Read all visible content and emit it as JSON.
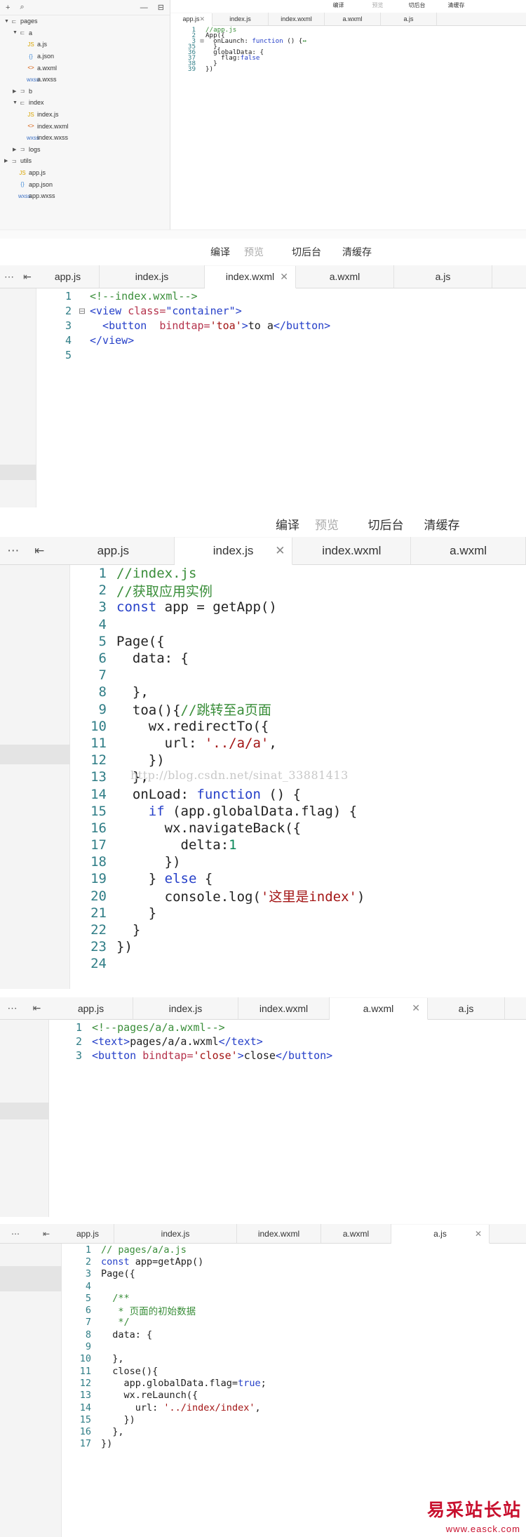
{
  "toolbar": {
    "compile": "编译",
    "preview": "预览",
    "background": "切后台",
    "clear_cache": "清缓存"
  },
  "tree": {
    "items": [
      {
        "label": "pages",
        "kind": "folder",
        "open": true,
        "level": 0
      },
      {
        "label": "a",
        "kind": "folder",
        "open": true,
        "level": 1
      },
      {
        "label": "a.js",
        "kind": "js",
        "level": 2
      },
      {
        "label": "a.json",
        "kind": "json",
        "level": 2
      },
      {
        "label": "a.wxml",
        "kind": "wxml",
        "level": 2
      },
      {
        "label": "a.wxss",
        "kind": "wxss",
        "level": 2
      },
      {
        "label": "b",
        "kind": "folder",
        "open": false,
        "level": 1
      },
      {
        "label": "index",
        "kind": "folder",
        "open": true,
        "level": 1
      },
      {
        "label": "index.js",
        "kind": "js",
        "level": 2
      },
      {
        "label": "index.wxml",
        "kind": "wxml",
        "level": 2
      },
      {
        "label": "index.wxss",
        "kind": "wxss",
        "level": 2
      },
      {
        "label": "logs",
        "kind": "folder",
        "open": false,
        "level": 1
      },
      {
        "label": "utils",
        "kind": "folder",
        "open": false,
        "level": 0
      },
      {
        "label": "app.js",
        "kind": "js",
        "level": 1
      },
      {
        "label": "app.json",
        "kind": "json",
        "level": 1
      },
      {
        "label": "app.wxss",
        "kind": "wxss",
        "level": 1
      }
    ]
  },
  "panels": [
    {
      "tabs": [
        "app.js",
        "index.js",
        "index.wxml",
        "a.wxml",
        "a.js"
      ],
      "active_tab": 0,
      "lines": [
        {
          "n": "1",
          "fold": "",
          "tokens": [
            {
              "t": "//app.js",
              "c": "c-cm"
            }
          ]
        },
        {
          "n": "2",
          "fold": "",
          "tokens": [
            {
              "t": "App({",
              "c": ""
            }
          ]
        },
        {
          "n": "3",
          "fold": "⊞",
          "tokens": [
            {
              "t": "  onLaunch: ",
              "c": ""
            },
            {
              "t": "function",
              "c": "c-kw"
            },
            {
              "t": " () {",
              "c": ""
            },
            {
              "t": "↔",
              "c": "c-cm"
            }
          ]
        },
        {
          "n": "35",
          "fold": "",
          "tokens": [
            {
              "t": "  },",
              "c": ""
            }
          ]
        },
        {
          "n": "36",
          "fold": "",
          "tokens": [
            {
              "t": "  globalData: {",
              "c": ""
            }
          ]
        },
        {
          "n": "37",
          "fold": "",
          "tokens": [
            {
              "t": "    flag:",
              "c": ""
            },
            {
              "t": "false",
              "c": "c-kw"
            }
          ]
        },
        {
          "n": "38",
          "fold": "",
          "tokens": [
            {
              "t": "  }",
              "c": ""
            }
          ]
        },
        {
          "n": "39",
          "fold": "",
          "tokens": [
            {
              "t": "})",
              "c": ""
            }
          ]
        }
      ]
    },
    {
      "tabs": [
        "app.js",
        "index.js",
        "index.wxml",
        "a.wxml",
        "a.js"
      ],
      "active_tab": 2,
      "lines": [
        {
          "n": "1",
          "fold": "",
          "tokens": [
            {
              "t": "<!--index.wxml-->",
              "c": "c-cm"
            }
          ]
        },
        {
          "n": "2",
          "fold": "⊟",
          "tokens": [
            {
              "t": "<view ",
              "c": "c-tg"
            },
            {
              "t": "class=",
              "c": "c-at"
            },
            {
              "t": "\"container\"",
              "c": "c-tg"
            },
            {
              "t": ">",
              "c": "c-tg"
            }
          ]
        },
        {
          "n": "3",
          "fold": "",
          "tokens": [
            {
              "t": "  <button  ",
              "c": "c-tg"
            },
            {
              "t": "bindtap=",
              "c": "c-at"
            },
            {
              "t": "'toa'",
              "c": "c-st"
            },
            {
              "t": ">",
              "c": "c-tg"
            },
            {
              "t": "to a",
              "c": ""
            },
            {
              "t": "</button>",
              "c": "c-tg"
            }
          ]
        },
        {
          "n": "4",
          "fold": "",
          "tokens": [
            {
              "t": "</view>",
              "c": "c-tg"
            }
          ]
        },
        {
          "n": "5",
          "fold": "",
          "tokens": []
        }
      ]
    },
    {
      "tabs": [
        "app.js",
        "index.js",
        "index.wxml",
        "a.wxml"
      ],
      "active_tab": 1,
      "lines": [
        {
          "n": "1",
          "fold": "",
          "tokens": [
            {
              "t": "//index.js",
              "c": "c-cm"
            }
          ]
        },
        {
          "n": "2",
          "fold": "",
          "tokens": [
            {
              "t": "//获取应用实例",
              "c": "c-cm"
            }
          ]
        },
        {
          "n": "3",
          "fold": "",
          "tokens": [
            {
              "t": "const",
              "c": "c-kw"
            },
            {
              "t": " app = getApp()",
              "c": ""
            }
          ]
        },
        {
          "n": "4",
          "fold": "",
          "tokens": []
        },
        {
          "n": "5",
          "fold": "",
          "tokens": [
            {
              "t": "Page({",
              "c": ""
            }
          ]
        },
        {
          "n": "6",
          "fold": "",
          "tokens": [
            {
              "t": "  data: {",
              "c": ""
            }
          ]
        },
        {
          "n": "7",
          "fold": "",
          "tokens": []
        },
        {
          "n": "8",
          "fold": "",
          "tokens": [
            {
              "t": "  },",
              "c": ""
            }
          ]
        },
        {
          "n": "9",
          "fold": "",
          "tokens": [
            {
              "t": "  toa(){",
              "c": ""
            },
            {
              "t": "//跳转至a页面",
              "c": "c-cm"
            }
          ]
        },
        {
          "n": "10",
          "fold": "",
          "tokens": [
            {
              "t": "    wx.redirectTo({",
              "c": ""
            }
          ]
        },
        {
          "n": "11",
          "fold": "",
          "tokens": [
            {
              "t": "      url: ",
              "c": ""
            },
            {
              "t": "'../a/a'",
              "c": "c-st"
            },
            {
              "t": ",",
              "c": ""
            }
          ]
        },
        {
          "n": "12",
          "fold": "",
          "tokens": [
            {
              "t": "    })",
              "c": ""
            }
          ]
        },
        {
          "n": "13",
          "fold": "",
          "tokens": [
            {
              "t": "  },",
              "c": ""
            }
          ]
        },
        {
          "n": "14",
          "fold": "",
          "tokens": [
            {
              "t": "  onLoad: ",
              "c": ""
            },
            {
              "t": "function",
              "c": "c-kw"
            },
            {
              "t": " () {",
              "c": ""
            }
          ]
        },
        {
          "n": "15",
          "fold": "",
          "tokens": [
            {
              "t": "    ",
              "c": ""
            },
            {
              "t": "if",
              "c": "c-kw"
            },
            {
              "t": " (app.globalData.flag) {",
              "c": ""
            }
          ]
        },
        {
          "n": "16",
          "fold": "",
          "tokens": [
            {
              "t": "      wx.navigateBack({",
              "c": ""
            }
          ]
        },
        {
          "n": "17",
          "fold": "",
          "tokens": [
            {
              "t": "        delta:",
              "c": ""
            },
            {
              "t": "1",
              "c": "c-nm"
            }
          ]
        },
        {
          "n": "18",
          "fold": "",
          "tokens": [
            {
              "t": "      })",
              "c": ""
            }
          ]
        },
        {
          "n": "19",
          "fold": "",
          "tokens": [
            {
              "t": "    } ",
              "c": ""
            },
            {
              "t": "else",
              "c": "c-kw"
            },
            {
              "t": " {",
              "c": ""
            }
          ]
        },
        {
          "n": "20",
          "fold": "",
          "tokens": [
            {
              "t": "      console.log(",
              "c": ""
            },
            {
              "t": "'这里是index'",
              "c": "c-st"
            },
            {
              "t": ")",
              "c": ""
            }
          ]
        },
        {
          "n": "21",
          "fold": "",
          "tokens": [
            {
              "t": "    }",
              "c": ""
            }
          ]
        },
        {
          "n": "22",
          "fold": "",
          "tokens": [
            {
              "t": "  }",
              "c": ""
            }
          ]
        },
        {
          "n": "23",
          "fold": "",
          "tokens": [
            {
              "t": "})",
              "c": ""
            }
          ]
        },
        {
          "n": "24",
          "fold": "",
          "tokens": []
        }
      ]
    },
    {
      "tabs": [
        "app.js",
        "index.js",
        "index.wxml",
        "a.wxml",
        "a.js"
      ],
      "active_tab": 3,
      "lines": [
        {
          "n": "1",
          "fold": "",
          "tokens": [
            {
              "t": "<!--pages/a/a.wxml-->",
              "c": "c-cm"
            }
          ]
        },
        {
          "n": "2",
          "fold": "",
          "tokens": [
            {
              "t": "<text>",
              "c": "c-tg"
            },
            {
              "t": "pages/a/a.wxml",
              "c": ""
            },
            {
              "t": "</text>",
              "c": "c-tg"
            }
          ]
        },
        {
          "n": "3",
          "fold": "",
          "tokens": [
            {
              "t": "<button ",
              "c": "c-tg"
            },
            {
              "t": "bindtap=",
              "c": "c-at"
            },
            {
              "t": "'close'",
              "c": "c-st"
            },
            {
              "t": ">",
              "c": "c-tg"
            },
            {
              "t": "close",
              "c": ""
            },
            {
              "t": "</button>",
              "c": "c-tg"
            }
          ]
        }
      ]
    },
    {
      "tabs": [
        "app.js",
        "index.js",
        "index.wxml",
        "a.wxml",
        "a.js"
      ],
      "active_tab": 4,
      "lines": [
        {
          "n": "1",
          "fold": "",
          "tokens": [
            {
              "t": "// pages/a/a.js",
              "c": "c-cm"
            }
          ]
        },
        {
          "n": "2",
          "fold": "",
          "tokens": [
            {
              "t": "const",
              "c": "c-kw"
            },
            {
              "t": " app=getApp()",
              "c": ""
            }
          ]
        },
        {
          "n": "3",
          "fold": "",
          "tokens": [
            {
              "t": "Page({",
              "c": ""
            }
          ]
        },
        {
          "n": "4",
          "fold": "",
          "tokens": []
        },
        {
          "n": "5",
          "fold": "",
          "tokens": [
            {
              "t": "  /**",
              "c": "c-doc"
            }
          ]
        },
        {
          "n": "6",
          "fold": "",
          "tokens": [
            {
              "t": "   * 页面的初始数据",
              "c": "c-doc"
            }
          ]
        },
        {
          "n": "7",
          "fold": "",
          "tokens": [
            {
              "t": "   */",
              "c": "c-doc"
            }
          ]
        },
        {
          "n": "8",
          "fold": "",
          "tokens": [
            {
              "t": "  data: {",
              "c": ""
            }
          ]
        },
        {
          "n": "9",
          "fold": "",
          "tokens": []
        },
        {
          "n": "10",
          "fold": "",
          "tokens": [
            {
              "t": "  },",
              "c": ""
            }
          ]
        },
        {
          "n": "11",
          "fold": "",
          "tokens": [
            {
              "t": "  close(){",
              "c": ""
            }
          ]
        },
        {
          "n": "12",
          "fold": "",
          "tokens": [
            {
              "t": "    app.globalData.flag=",
              "c": ""
            },
            {
              "t": "true",
              "c": "c-kw"
            },
            {
              "t": ";",
              "c": ""
            }
          ]
        },
        {
          "n": "13",
          "fold": "",
          "tokens": [
            {
              "t": "    wx.reLaunch({",
              "c": ""
            }
          ]
        },
        {
          "n": "14",
          "fold": "",
          "tokens": [
            {
              "t": "      url: ",
              "c": ""
            },
            {
              "t": "'../index/index'",
              "c": "c-st"
            },
            {
              "t": ",",
              "c": ""
            }
          ]
        },
        {
          "n": "15",
          "fold": "",
          "tokens": [
            {
              "t": "    })",
              "c": ""
            }
          ]
        },
        {
          "n": "16",
          "fold": "",
          "tokens": [
            {
              "t": "  },",
              "c": ""
            }
          ]
        },
        {
          "n": "17",
          "fold": "",
          "tokens": [
            {
              "t": "})",
              "c": ""
            }
          ]
        }
      ]
    }
  ],
  "watermark": {
    "url": "http://blog.csdn.net/sinat_33881413",
    "brand": "易采站长站",
    "brand_url": "www.easck.com"
  },
  "colors": {
    "line_number": "#2f7d86",
    "comment": "#3a8e3a",
    "keyword": "#2640c9",
    "string": "#a31515",
    "brand": "#c8102e"
  }
}
